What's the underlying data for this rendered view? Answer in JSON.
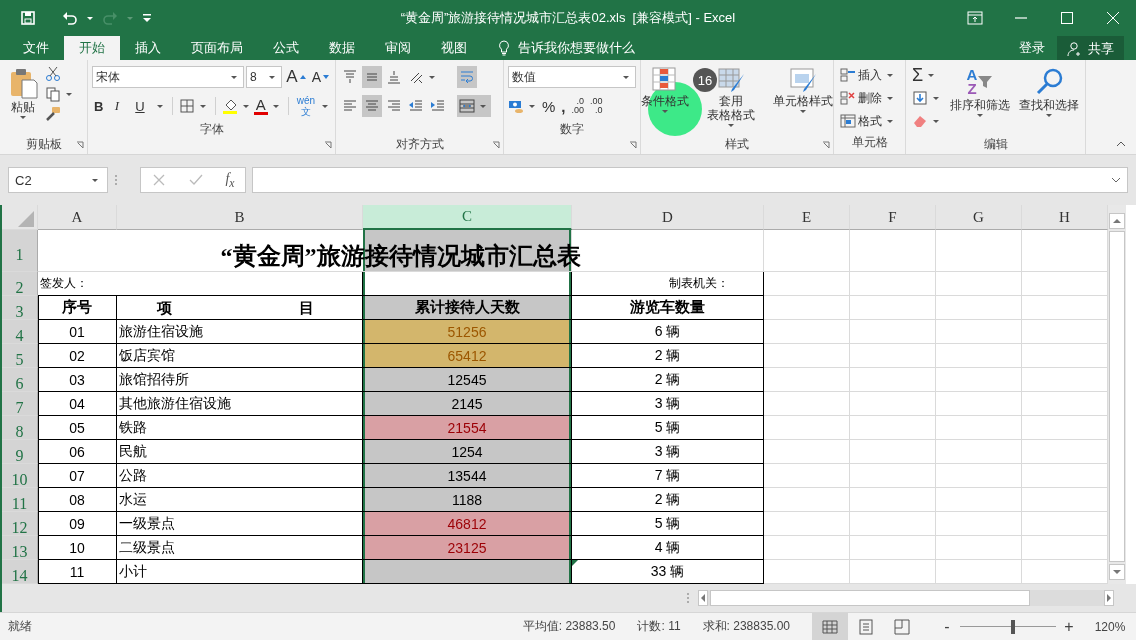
{
  "window": {
    "title": "“黄金周”旅游接待情况城市汇总表02.xls  [兼容模式] - Excel",
    "redo_disabled": true
  },
  "menu_tabs": [
    {
      "label": "文件",
      "selected": false
    },
    {
      "label": "开始",
      "selected": true
    },
    {
      "label": "插入",
      "selected": false
    },
    {
      "label": "页面布局",
      "selected": false
    },
    {
      "label": "公式",
      "selected": false
    },
    {
      "label": "数据",
      "selected": false
    },
    {
      "label": "审阅",
      "selected": false
    },
    {
      "label": "视图",
      "selected": false
    }
  ],
  "tell_me": "告诉我你想要做什么",
  "sign_in": "登录",
  "share": "共享",
  "ribbon": {
    "clipboard": {
      "label": "剪贴板",
      "paste": "粘贴"
    },
    "font": {
      "label": "字体",
      "font_name": "宋体",
      "font_size": "8",
      "grow": "A",
      "shrink": "A",
      "bold": "B",
      "italic": "I",
      "underline": "U",
      "font_color": "A",
      "phonetic": "wén",
      "phonetic_char": "文"
    },
    "alignment": {
      "label": "对齐方式",
      "buttons": [
        {
          "kind": "top",
          "on": false
        },
        {
          "kind": "middle",
          "on": true
        },
        {
          "kind": "bottom",
          "on": false
        },
        {
          "kind": "orient",
          "on": false
        },
        {
          "kind": "wrap",
          "on": true
        },
        {
          "kind": "left",
          "on": false
        },
        {
          "kind": "center",
          "on": true
        },
        {
          "kind": "right",
          "on": false
        },
        {
          "kind": "outdent",
          "on": false
        },
        {
          "kind": "indent",
          "on": false
        },
        {
          "kind": "merge",
          "on": true
        }
      ]
    },
    "number": {
      "label": "数字",
      "format": "数值",
      "percent": "%",
      "comma": ",",
      "increase_decimal": [
        ".0",
        ".00"
      ],
      "decrease_decimal": [
        ".00",
        ".0"
      ]
    },
    "styles": {
      "label": "样式",
      "items": [
        {
          "kind": "conditional",
          "lines": [
            "条件格式"
          ]
        },
        {
          "kind": "table",
          "lines": [
            "套用",
            "表格格式"
          ]
        },
        {
          "kind": "cell",
          "lines": [
            "单元格样式"
          ]
        }
      ]
    },
    "cells": {
      "label": "单元格",
      "items": [
        {
          "kind": "insert",
          "label": "插入"
        },
        {
          "kind": "delete",
          "label": "删除"
        },
        {
          "kind": "format",
          "label": "格式"
        }
      ]
    },
    "editing": {
      "label": "编辑",
      "sum": "Σ",
      "sort_letters": [
        "A",
        "Z"
      ],
      "sort": "排序和筛选",
      "find": "查找和选择"
    }
  },
  "click_marker": {
    "label": "16"
  },
  "formula_bar": {
    "name_box": "C2",
    "function": "f$_{x}$"
  },
  "sheet": {
    "columns": [
      {
        "label": "A",
        "selected": false
      },
      {
        "label": "B",
        "selected": false
      },
      {
        "label": "C",
        "selected": true
      },
      {
        "label": "D",
        "selected": false
      },
      {
        "label": "E",
        "selected": false
      },
      {
        "label": "F",
        "selected": false
      },
      {
        "label": "G",
        "selected": false
      },
      {
        "label": "H",
        "selected": false
      }
    ],
    "row_headers": [
      {
        "label": "1",
        "selected": true
      },
      {
        "label": "2",
        "selected": true
      },
      {
        "label": "3",
        "selected": true
      },
      {
        "label": "4",
        "selected": true
      },
      {
        "label": "5",
        "selected": true
      },
      {
        "label": "6",
        "selected": true
      },
      {
        "label": "7",
        "selected": true
      },
      {
        "label": "8",
        "selected": true
      },
      {
        "label": "9",
        "selected": true
      },
      {
        "label": "10",
        "selected": true
      },
      {
        "label": "11",
        "selected": true
      },
      {
        "label": "12",
        "selected": true
      },
      {
        "label": "13",
        "selected": true
      },
      {
        "label": "14",
        "selected": true
      }
    ],
    "title": "“黄金周”旅游接待情况城市汇总表",
    "issuer": "签发人：",
    "maker": "制表机关：",
    "header": [
      "序号",
      "项 目",
      "累计接待人天数",
      "游览车数量"
    ],
    "rows": [
      {
        "kind": "neutral",
        "no": "01",
        "item": "旅游住宿设施",
        "visits": "51256",
        "buses": "6 辆",
        "flagged": false
      },
      {
        "kind": "neutral",
        "no": "02",
        "item": "饭店宾馆",
        "visits": "65412",
        "buses": "2 辆",
        "flagged": false
      },
      {
        "kind": "plain",
        "no": "03",
        "item": "旅馆招待所",
        "visits": "12545",
        "buses": "2 辆",
        "flagged": false
      },
      {
        "kind": "plain",
        "no": "04",
        "item": "其他旅游住宿设施",
        "visits": "2145",
        "buses": "3 辆",
        "flagged": false
      },
      {
        "kind": "bad",
        "no": "05",
        "item": "铁路",
        "visits": "21554",
        "buses": "5 辆",
        "flagged": false
      },
      {
        "kind": "plain",
        "no": "06",
        "item": "民航",
        "visits": "1254",
        "buses": "3 辆",
        "flagged": false
      },
      {
        "kind": "plain",
        "no": "07",
        "item": "公路",
        "visits": "13544",
        "buses": "7 辆",
        "flagged": false
      },
      {
        "kind": "plain",
        "no": "08",
        "item": "水运",
        "visits": "1188",
        "buses": "2 辆",
        "flagged": false
      },
      {
        "kind": "bad",
        "no": "09",
        "item": "一级景点",
        "visits": "46812",
        "buses": "5 辆",
        "flagged": false
      },
      {
        "kind": "bad",
        "no": "10",
        "item": "二级景点",
        "visits": "23125",
        "buses": "4 辆",
        "flagged": false
      },
      {
        "kind": "plain",
        "no": "11",
        "item": "小计",
        "buses": "33 辆",
        "flagged": true
      }
    ]
  },
  "status_bar": {
    "status": "就绪",
    "average": "平均值: 23883.50",
    "count": "计数: 11",
    "sum": "求和: 238835.00",
    "views": [
      {
        "kind": "normal",
        "selected": true
      },
      {
        "kind": "page_layout",
        "selected": false
      },
      {
        "kind": "page_break",
        "selected": false
      }
    ],
    "zoom_out": "-",
    "zoom_in": "+",
    "zoom": {
      "level": 0.55
    },
    "zoom_label": "120%"
  }
}
